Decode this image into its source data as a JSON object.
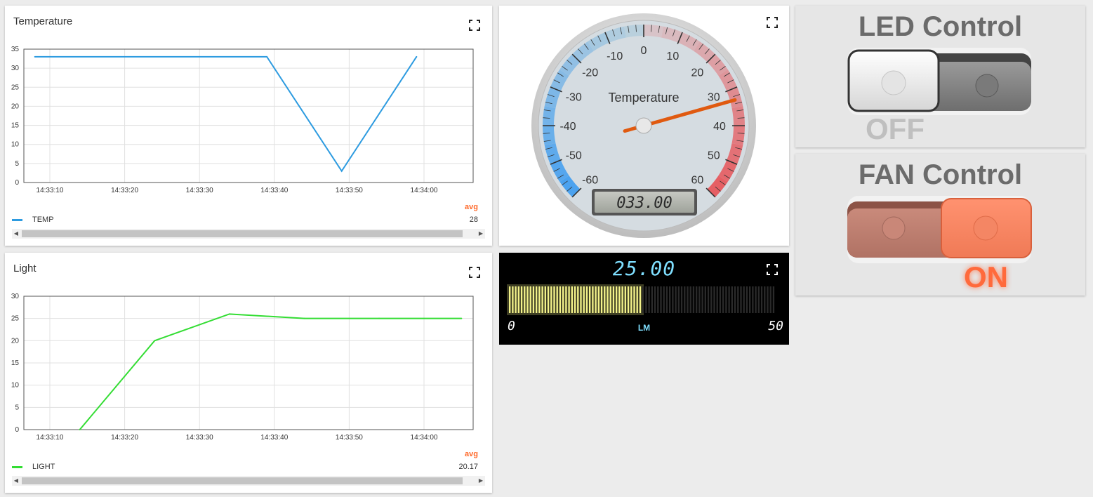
{
  "temperature_chart": {
    "title": "Temperature",
    "avg_label": "avg",
    "legend": {
      "name": "TEMP",
      "avg_value": "28",
      "color": "#2d9be0"
    }
  },
  "light_chart": {
    "title": "Light",
    "avg_label": "avg",
    "legend": {
      "name": "LIGHT",
      "avg_value": "20.17",
      "color": "#33dd33"
    }
  },
  "gauge": {
    "title": "Temperature",
    "display_value": "033.00",
    "value": 33,
    "min": -60,
    "max": 60,
    "tick_labels": [
      "-60",
      "-50",
      "-40",
      "-30",
      "-20",
      "-10",
      "0",
      "10",
      "20",
      "30",
      "40",
      "50",
      "60"
    ],
    "needle_color": "#e05a10"
  },
  "light_bar": {
    "display_value": "25.00",
    "value": 25,
    "min_label": "0",
    "max_label": "50",
    "unit": "LM",
    "bar_color": "#f3f28a"
  },
  "led_control": {
    "title": "LED Control",
    "state_label": "OFF",
    "state": "off"
  },
  "fan_control": {
    "title": "FAN Control",
    "state_label": "ON",
    "state": "on",
    "accent": "#ff8060"
  },
  "chart_data": [
    {
      "type": "line",
      "title": "Temperature",
      "x": [
        "14:33:10",
        "14:33:20",
        "14:33:30",
        "14:33:40",
        "14:33:50",
        "14:34:00"
      ],
      "xlabel": "",
      "ylabel": "",
      "ylim": [
        0,
        35
      ],
      "yticks": [
        "0",
        "5",
        "10",
        "15",
        "20",
        "25",
        "30",
        "35"
      ],
      "grid": true,
      "legend": "bottom-left",
      "series": [
        {
          "name": "TEMP",
          "points": [
            [
              "14:33:08",
              33
            ],
            [
              "14:33:39",
              33
            ],
            [
              "14:33:49",
              3
            ],
            [
              "14:33:59",
              33
            ]
          ]
        }
      ]
    },
    {
      "type": "line",
      "title": "Light",
      "x": [
        "14:33:10",
        "14:33:20",
        "14:33:30",
        "14:33:40",
        "14:33:50",
        "14:34:00"
      ],
      "xlabel": "",
      "ylabel": "",
      "ylim": [
        0,
        30
      ],
      "yticks": [
        "0",
        "5",
        "10",
        "15",
        "20",
        "25",
        "30"
      ],
      "grid": true,
      "legend": "bottom-left",
      "series": [
        {
          "name": "LIGHT",
          "points": [
            [
              "14:33:14",
              0
            ],
            [
              "14:33:24",
              20
            ],
            [
              "14:33:34",
              26
            ],
            [
              "14:33:44",
              25
            ],
            [
              "14:33:54",
              25
            ],
            [
              "14:34:05",
              25
            ]
          ]
        }
      ]
    }
  ]
}
